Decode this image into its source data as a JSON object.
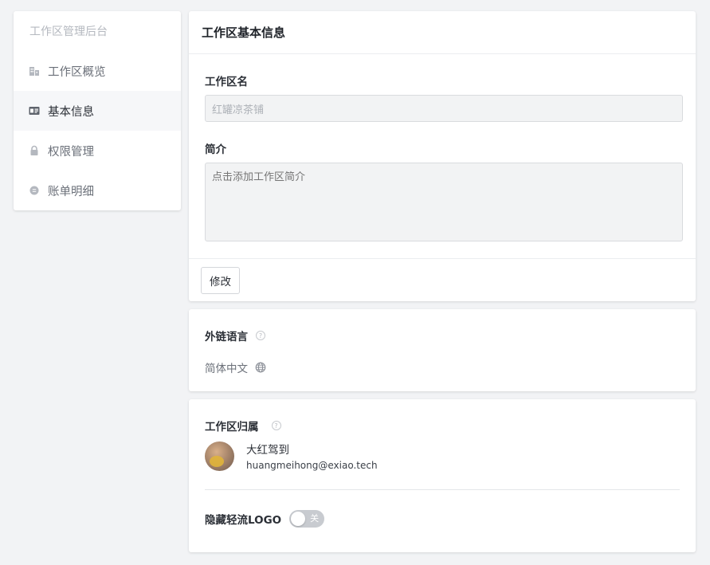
{
  "sidebar": {
    "header": "工作区管理后台",
    "items": [
      {
        "label": "工作区概览",
        "icon": "building-icon",
        "active": false
      },
      {
        "label": "基本信息",
        "icon": "id-card-icon",
        "active": true
      },
      {
        "label": "权限管理",
        "icon": "lock-icon",
        "active": false
      },
      {
        "label": "账单明细",
        "icon": "coin-icon",
        "active": false
      }
    ]
  },
  "basic_info": {
    "title": "工作区基本信息",
    "name_label": "工作区名",
    "name_value": "红罐凉茶铺",
    "intro_label": "简介",
    "intro_placeholder": "点击添加工作区简介",
    "edit_button": "修改"
  },
  "link_language": {
    "label": "外链语言",
    "value": "简体中文"
  },
  "ownership": {
    "label": "工作区归属",
    "owner_name": "大红驾到",
    "owner_email": "huangmeihong@exiao.tech",
    "hide_logo_label": "隐藏轻流LOGO",
    "hide_logo_state": "关"
  },
  "colors": {
    "background": "#f2f3f5",
    "toggle_off": "#c8cbd0"
  }
}
